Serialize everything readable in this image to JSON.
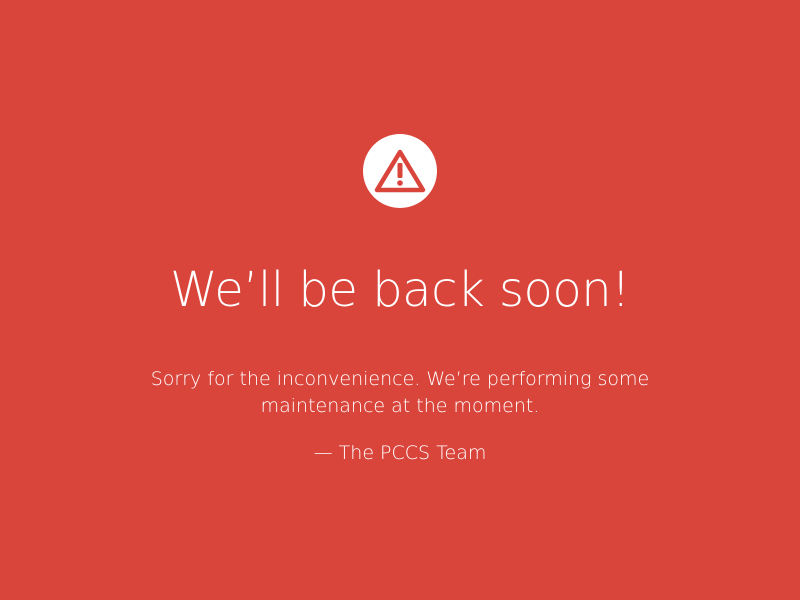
{
  "page": {
    "background_color": "#d9443b",
    "icon": "warning-triangle-icon",
    "title": "We’ll be back soon!",
    "message": "Sorry for the inconvenience. We’re performing some maintenance at the moment.",
    "signature": "— The PCCS Team"
  }
}
